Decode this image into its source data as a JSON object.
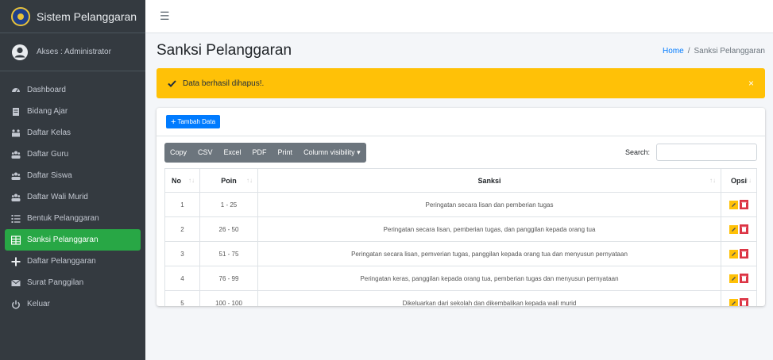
{
  "app": {
    "brand": "Sistem Pelanggaran",
    "user": "Akses : Administrator"
  },
  "sidebar": {
    "items": [
      {
        "label": "Dashboard",
        "icon": "dashboard-icon",
        "active": false
      },
      {
        "label": "Bidang Ajar",
        "icon": "book-icon",
        "active": false
      },
      {
        "label": "Daftar Kelas",
        "icon": "class-icon",
        "active": false
      },
      {
        "label": "Daftar Guru",
        "icon": "users-icon",
        "active": false
      },
      {
        "label": "Daftar Siswa",
        "icon": "users-icon",
        "active": false
      },
      {
        "label": "Daftar Wali Murid",
        "icon": "users-icon",
        "active": false
      },
      {
        "label": "Bentuk Pelanggaran",
        "icon": "list-icon",
        "active": false
      },
      {
        "label": "Sanksi Pelanggaran",
        "icon": "table-icon",
        "active": true
      },
      {
        "label": "Daftar Pelanggaran",
        "icon": "plus-icon",
        "active": false
      },
      {
        "label": "Surat Panggilan",
        "icon": "mail-icon",
        "active": false
      },
      {
        "label": "Keluar",
        "icon": "power-icon",
        "active": false
      }
    ]
  },
  "header": {
    "title": "Sanksi Pelanggaran",
    "breadcrumb_home": "Home",
    "breadcrumb_sep": "/",
    "breadcrumb_current": "Sanksi Pelanggaran"
  },
  "alert": {
    "message": "Data berhasil dihapus!.",
    "close": "×",
    "color": "#ffc107"
  },
  "actions": {
    "add_label": "Tambah Data",
    "add_plus": "+"
  },
  "toolbar": {
    "buttons": [
      "Copy",
      "CSV",
      "Excel",
      "PDF",
      "Print",
      "Column visibility ▾"
    ],
    "search_label": "Search:",
    "search_value": ""
  },
  "table": {
    "headers": {
      "no": "No",
      "poin": "Poin",
      "sanksi": "Sanksi",
      "opsi": "Opsi"
    },
    "sort_glyph": "↑↓",
    "sort_glyph_no": "↑↓",
    "rows": [
      {
        "no": "1",
        "poin": "1 - 25",
        "sanksi": "Peringatan secara lisan dan pemberian tugas"
      },
      {
        "no": "2",
        "poin": "26 - 50",
        "sanksi": "Peringatan secara lisan, pemberian tugas, dan panggilan kepada orang tua"
      },
      {
        "no": "3",
        "poin": "51 - 75",
        "sanksi": "Peringatan secara lisan, pemverian tugas, panggilan kepada orang tua dan menyusun pernyataan"
      },
      {
        "no": "4",
        "poin": "76 - 99",
        "sanksi": "Peringatan keras, panggilan kepada orang tua, pemberian tugas dan menyusun pernyataan"
      },
      {
        "no": "5",
        "poin": "100 - 100",
        "sanksi": "Dikeluarkan dari sekolah dan dikembalikan kepada wali murid"
      }
    ]
  },
  "colors": {
    "sidebar": "#343a40",
    "active": "#28a745",
    "primary": "#007bff",
    "edit": "#ffc107",
    "delete": "#dc3545"
  }
}
